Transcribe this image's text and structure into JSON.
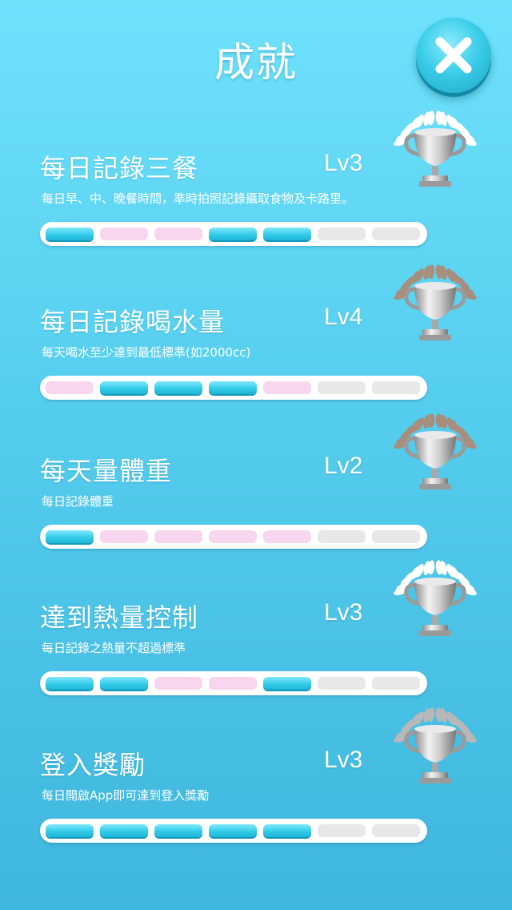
{
  "header": {
    "title": "成就"
  },
  "achievements": [
    {
      "name": "每日記錄三餐",
      "level": "Lv3",
      "description": "每日早、中、晚餐時間，準時拍照記錄攝取食物及卡路里。",
      "segments": [
        "done",
        "pink",
        "pink",
        "done",
        "done",
        "empty",
        "empty"
      ],
      "wreath_color": "#ffffff",
      "trophy_icon": "trophy-white-wreath-icon"
    },
    {
      "name": "每日記錄喝水量",
      "level": "Lv4",
      "description": "每天喝水至少達到最低標準(如2000cc)",
      "segments": [
        "pink",
        "done",
        "done",
        "done",
        "pink",
        "empty",
        "empty"
      ],
      "wreath_color": "#a88e7c",
      "trophy_icon": "trophy-white-bronze-wreath-icon"
    },
    {
      "name": "每天量體重",
      "level": "Lv2",
      "description": "每日記錄體重",
      "segments": [
        "done",
        "pink",
        "pink",
        "pink",
        "pink",
        "empty",
        "empty"
      ],
      "wreath_color": "#a88e7c",
      "trophy_icon": "trophy-bronze-wreath-icon"
    },
    {
      "name": "達到熱量控制",
      "level": "Lv3",
      "description": "每日記錄之熱量不超過標準",
      "segments": [
        "done",
        "done",
        "pink",
        "pink",
        "done",
        "empty",
        "empty"
      ],
      "wreath_color": "#ffffff",
      "trophy_icon": "trophy-white-silver-wreath-icon"
    },
    {
      "name": "登入獎勵",
      "level": "Lv3",
      "description": "每日開啟App即可達到登入獎勵",
      "segments": [
        "done",
        "done",
        "done",
        "done",
        "done",
        "empty",
        "empty"
      ],
      "wreath_color": "#b8b8b8",
      "trophy_icon": "trophy-silver-wreath-icon"
    }
  ]
}
